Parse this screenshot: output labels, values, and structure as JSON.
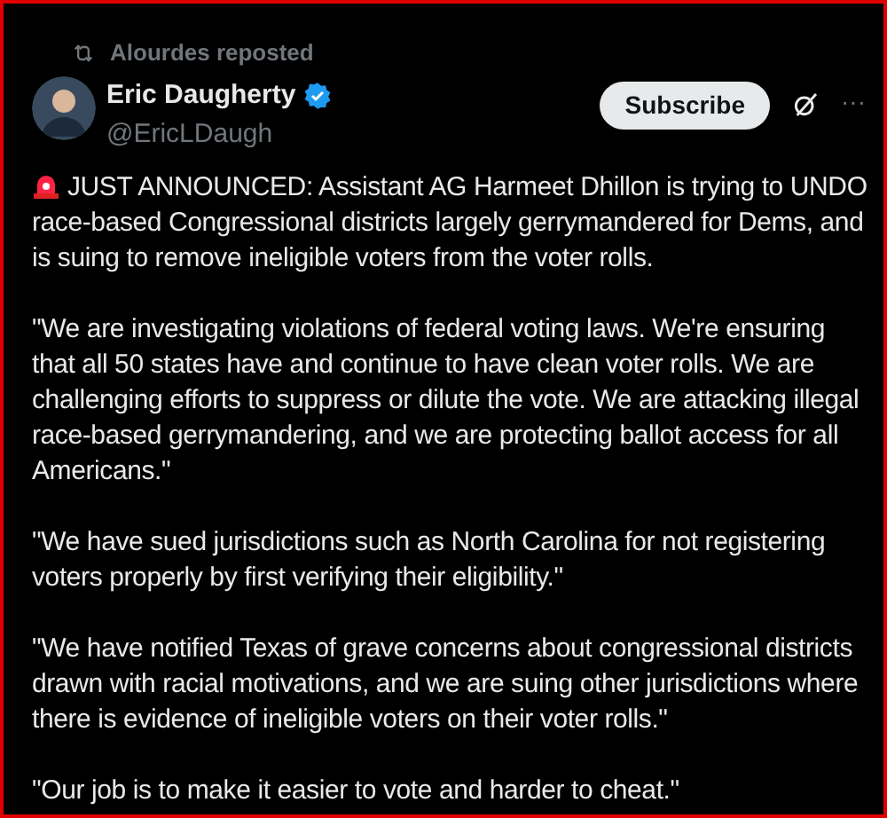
{
  "repost": {
    "label": "Alourdes reposted"
  },
  "author": {
    "name": "Eric Daugherty",
    "verified": true,
    "handle": "@EricLDaugh"
  },
  "subscribe_button": "Subscribe",
  "more_button": "···",
  "paragraphs": [
    "JUST ANNOUNCED: Assistant AG Harmeet Dhillon is trying to UNDO race-based Congressional districts largely gerrymandered for Dems, and is suing to remove ineligible voters from the voter rolls.",
    "\"We are investigating violations of federal voting laws. We're ensuring that all 50 states have and continue to have clean voter rolls. We are challenging efforts to suppress or dilute the vote. We are attacking illegal race-based gerrymandering, and we are protecting ballot access for all Americans.\"",
    "\"We have sued jurisdictions such as North Carolina for not registering voters properly by first verifying their eligibility.\"",
    "\"We have notified Texas of grave concerns about congressional districts drawn with racial motivations, and we are suing other jurisdictions where there is evidence of ineligible voters on their voter rolls.\"",
    "\"Our job is to make it easier to vote and harder to cheat.\""
  ]
}
